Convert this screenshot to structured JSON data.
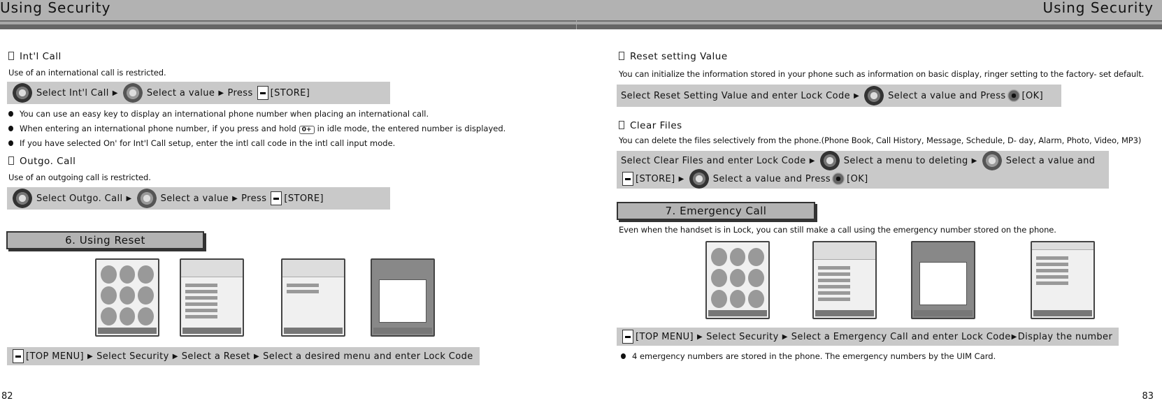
{
  "header": {
    "title_left": "Using Security",
    "title_right": "Using Security"
  },
  "left": {
    "intl_call": {
      "title": "Int'l Call",
      "desc": "Use of an international call is restricted.",
      "step": {
        "s1": "Select Int'l Call",
        "s2": "Select a value",
        "s3": "Press",
        "s4": "[STORE]"
      },
      "bullets": [
        "You can use an easy key to display an international phone number when placing an international call.",
        "When entering an international phone number, if you press and hold",
        "in idle mode, the entered number is displayed.",
        "If you have selected  On'  for Int'l Call setup, enter the intl call code in the intl call input mode."
      ],
      "key_label": "0+"
    },
    "outgo_call": {
      "title": "Outgo. Call",
      "desc": "Use of an outgoing call is restricted.",
      "step": {
        "s1": "Select Outgo. Call",
        "s2": "Select a value",
        "s3": "Press",
        "s4": "[STORE]"
      }
    },
    "chapter": "6. Using Reset",
    "reset_step": {
      "s1": "[TOP MENU]",
      "s2": "Select Security",
      "s3": "Select a Reset",
      "s4": "Select a desired menu and enter Lock Code"
    },
    "page_number": "82"
  },
  "right": {
    "reset_value": {
      "title": "Reset setting Value",
      "desc": "You can initialize the information stored in your phone such as information on basic display, ringer setting to the factory- set default.",
      "step": {
        "s1": "Select Reset Setting Value and enter Lock Code",
        "s2": "Select a value and Press",
        "s3": "[OK]"
      }
    },
    "clear_files": {
      "title": "Clear Files",
      "desc": "You can delete the files selectively from the phone.(Phone Book, Call History, Message, Schedule, D- day, Alarm, Photo, Video, MP3)",
      "step": {
        "s1": "Select Clear Files and enter Lock Code",
        "s2": "Select a menu to deleting",
        "s3": "Select a value and",
        "s4": "[STORE]",
        "s5": "Select a value and Press",
        "s6": "[OK]"
      }
    },
    "chapter": "7. Emergency Call",
    "emergency_desc": "Even when the handset is in Lock, you can still make a call using the emergency number stored on the phone.",
    "emergency_step": {
      "s1": "[TOP MENU]",
      "s2": "Select Security",
      "s3": "Select a Emergency Call and enter Lock Code",
      "s4": "Display the number"
    },
    "bullet": "4 emergency numbers are stored in the phone. The emergency numbers by the UIM Card.",
    "page_number": "83"
  },
  "icons": {
    "arrow": "▶"
  }
}
